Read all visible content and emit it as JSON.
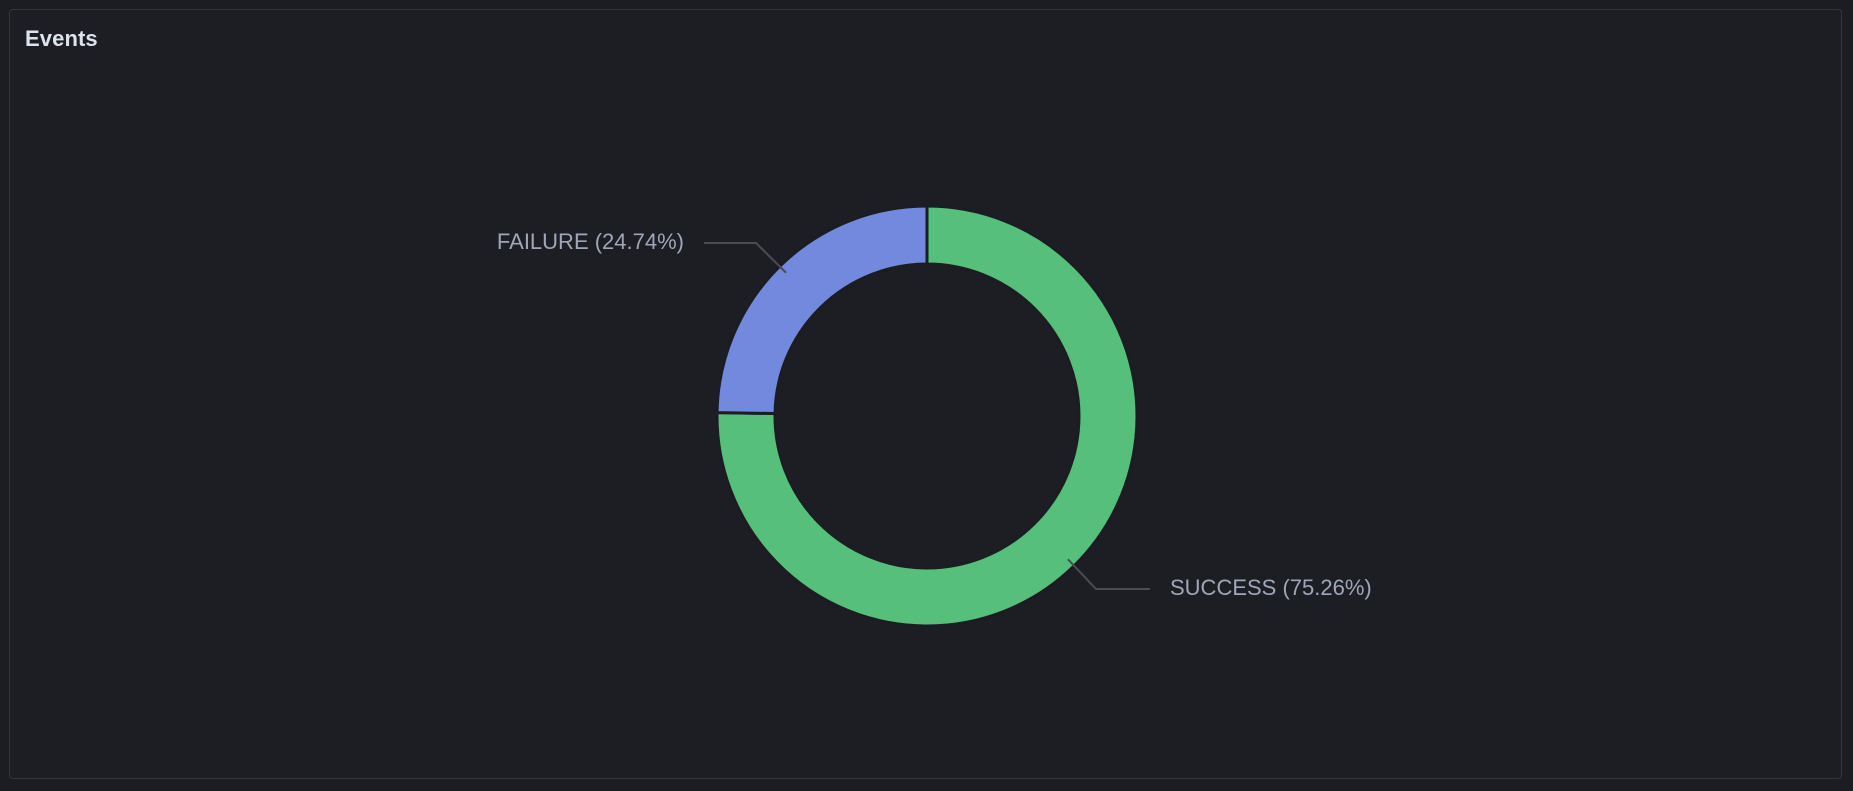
{
  "panel": {
    "title": "Events"
  },
  "chart_data": {
    "type": "pie",
    "variant": "donut",
    "slices": [
      {
        "label": "SUCCESS",
        "percent": 75.26,
        "display": "SUCCESS (75.26%)",
        "color": "#56bf7b"
      },
      {
        "label": "FAILURE",
        "percent": 24.74,
        "display": "FAILURE (24.74%)",
        "color": "#7289de"
      }
    ],
    "title": "",
    "legend": "none"
  },
  "colors": {
    "background": "#1c1d22",
    "border": "#34363d",
    "title": "#dde3ee",
    "label": "#9ea6b8",
    "leader_line": "#4a4c53"
  }
}
